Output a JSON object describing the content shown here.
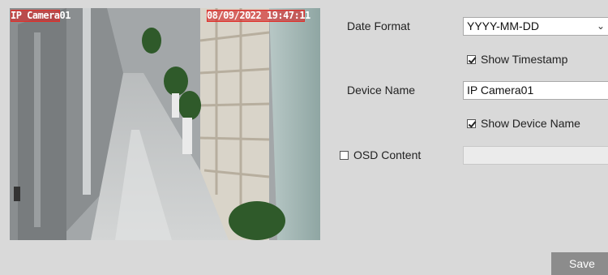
{
  "preview": {
    "osd_name": "IP Camera01",
    "osd_time": "08/09/2022 19:47:11"
  },
  "settings": {
    "date_format_label": "Date Format",
    "date_format_value": "YYYY-MM-DD",
    "show_timestamp_label": "Show Timestamp",
    "show_timestamp_checked": true,
    "device_name_label": "Device Name",
    "device_name_value": "IP Camera01",
    "show_device_name_label": "Show Device Name",
    "show_device_name_checked": true,
    "osd_content_label": "OSD Content",
    "osd_content_checked": false,
    "osd_content_value": ""
  },
  "actions": {
    "save_label": "Save"
  },
  "icons": {
    "dropdown": "chevron-down-icon",
    "checkbox_checked": "checkbox-checked-icon",
    "checkbox_unchecked": "checkbox-unchecked-icon"
  },
  "colors": {
    "background": "#d9d9d9",
    "save_button": "#8c8c8c",
    "osd_highlight": "#d22828"
  }
}
